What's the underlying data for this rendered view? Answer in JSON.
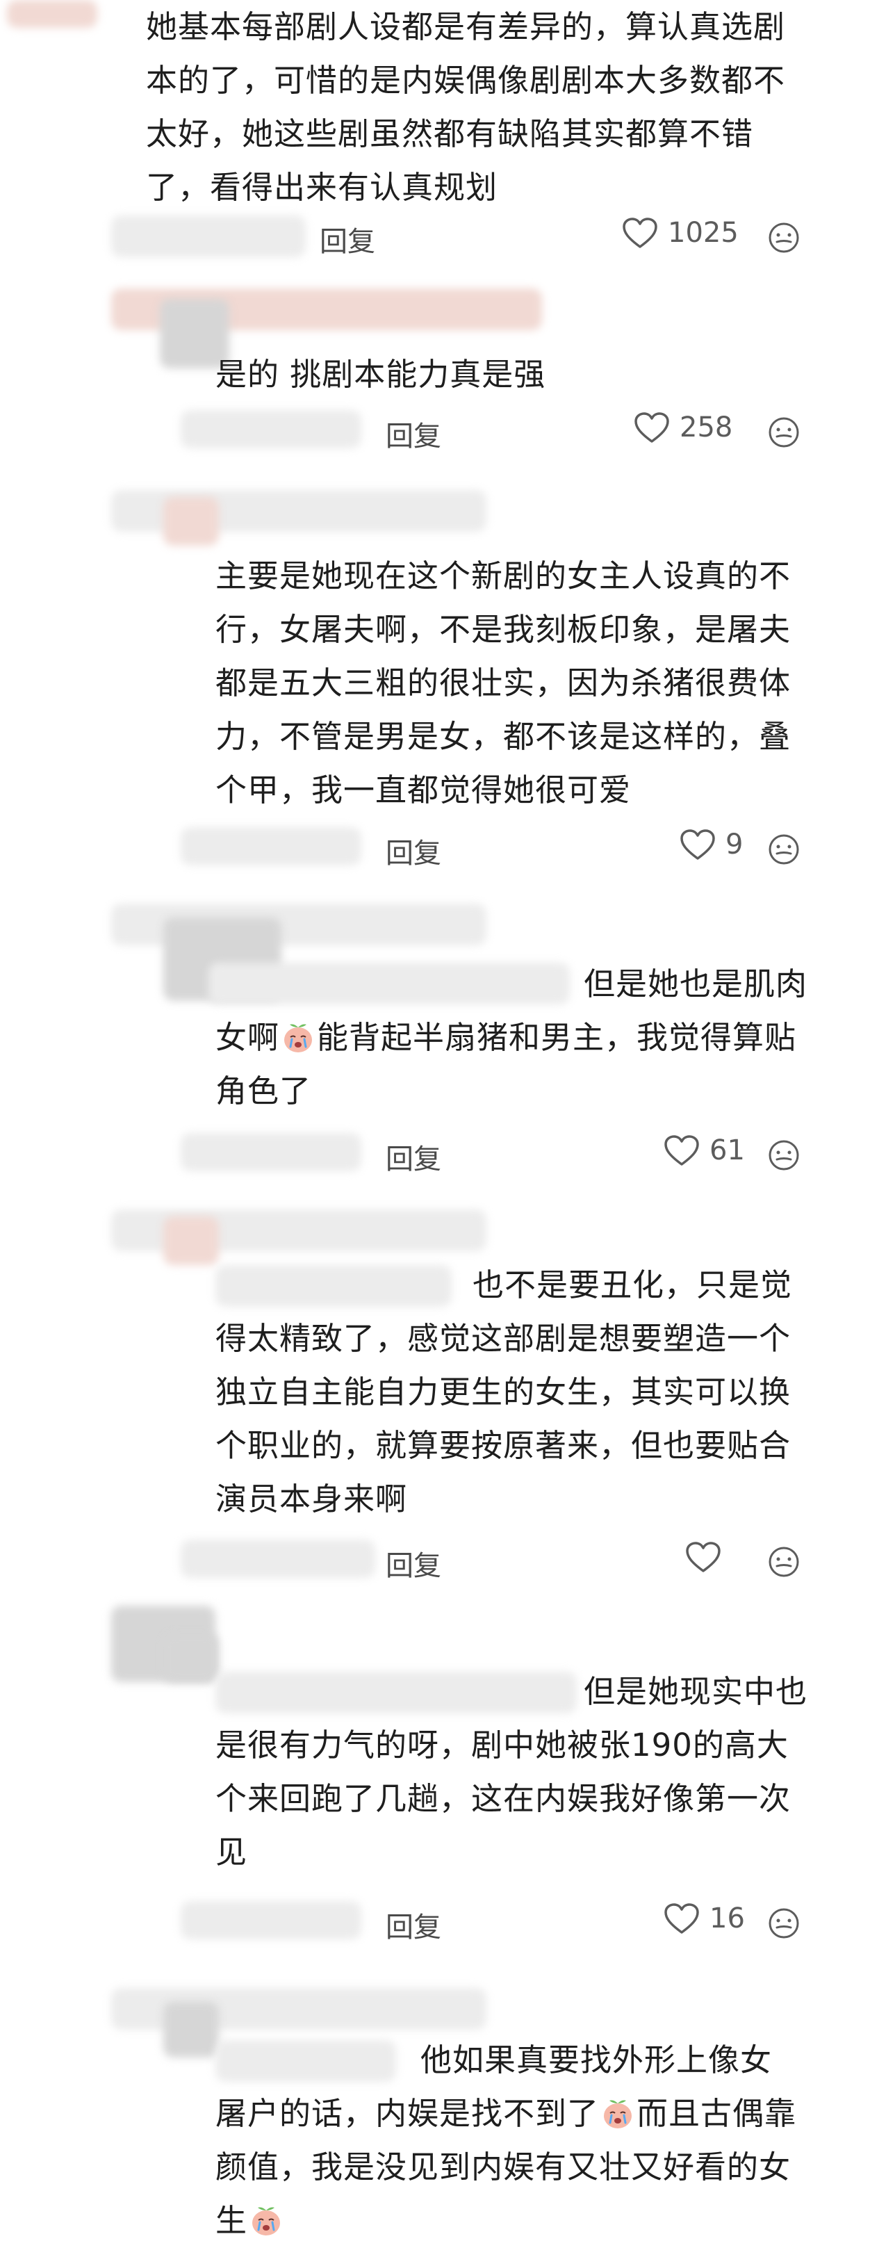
{
  "comments": [
    {
      "lines": [
        "她基本每部剧人设都是有差异的，算认真选剧",
        "本的了，可惜的是内娱偶像剧剧本大多数都不",
        "太好，她这些剧虽然都有缺陷其实都算不错",
        "了，看得出来有认真规划"
      ],
      "reply_label": "回复",
      "likes": "1025"
    },
    {
      "lines": [
        "是的  挑剧本能力真是强"
      ],
      "reply_label": "回复",
      "likes": "258"
    },
    {
      "lines": [
        "主要是她现在这个新剧的女主人设真的不",
        "行，女屠夫啊，不是我刻板印象，是屠夫",
        "都是五大三粗的很壮实，因为杀猪很费体",
        "力，不管是男是女，都不该是这样的，叠",
        "个甲，我一直都觉得她很可爱"
      ],
      "reply_label": "回复",
      "likes": "9"
    },
    {
      "lines": [
        "但是她也是肌肉",
        "女啊",
        "能背起半扇猪和男主，我觉得算贴",
        "角色了"
      ],
      "reply_label": "回复",
      "likes": "61"
    },
    {
      "lines": [
        "也不是要丑化，只是觉",
        "得太精致了，感觉这部剧是想要塑造一个",
        "独立自主能自力更生的女生，其实可以换",
        "个职业的，就算要按原著来，但也要贴合",
        "演员本身来啊"
      ],
      "reply_label": "回复",
      "likes": ""
    },
    {
      "lines": [
        "但是她现实中也",
        "是很有力气的呀，剧中她被张190的高大",
        "个来回跑了几趟，这在内娱我好像第一次",
        "见"
      ],
      "reply_label": "回复",
      "likes": "16"
    },
    {
      "lines": [
        "他如果真要找外形上像女",
        "屠户的话，内娱是找不到了",
        "而且古偶靠",
        "颜值，我是没见到内娱有又壮又好看的女",
        "生"
      ]
    }
  ],
  "icons": {
    "like": "heart-outline-icon",
    "more": "more-options-icon",
    "emoji": "crying-peach-emoji"
  },
  "colors": {
    "text": "#1e1e1e",
    "meta": "#5c5c5c",
    "background": "#ffffff"
  }
}
